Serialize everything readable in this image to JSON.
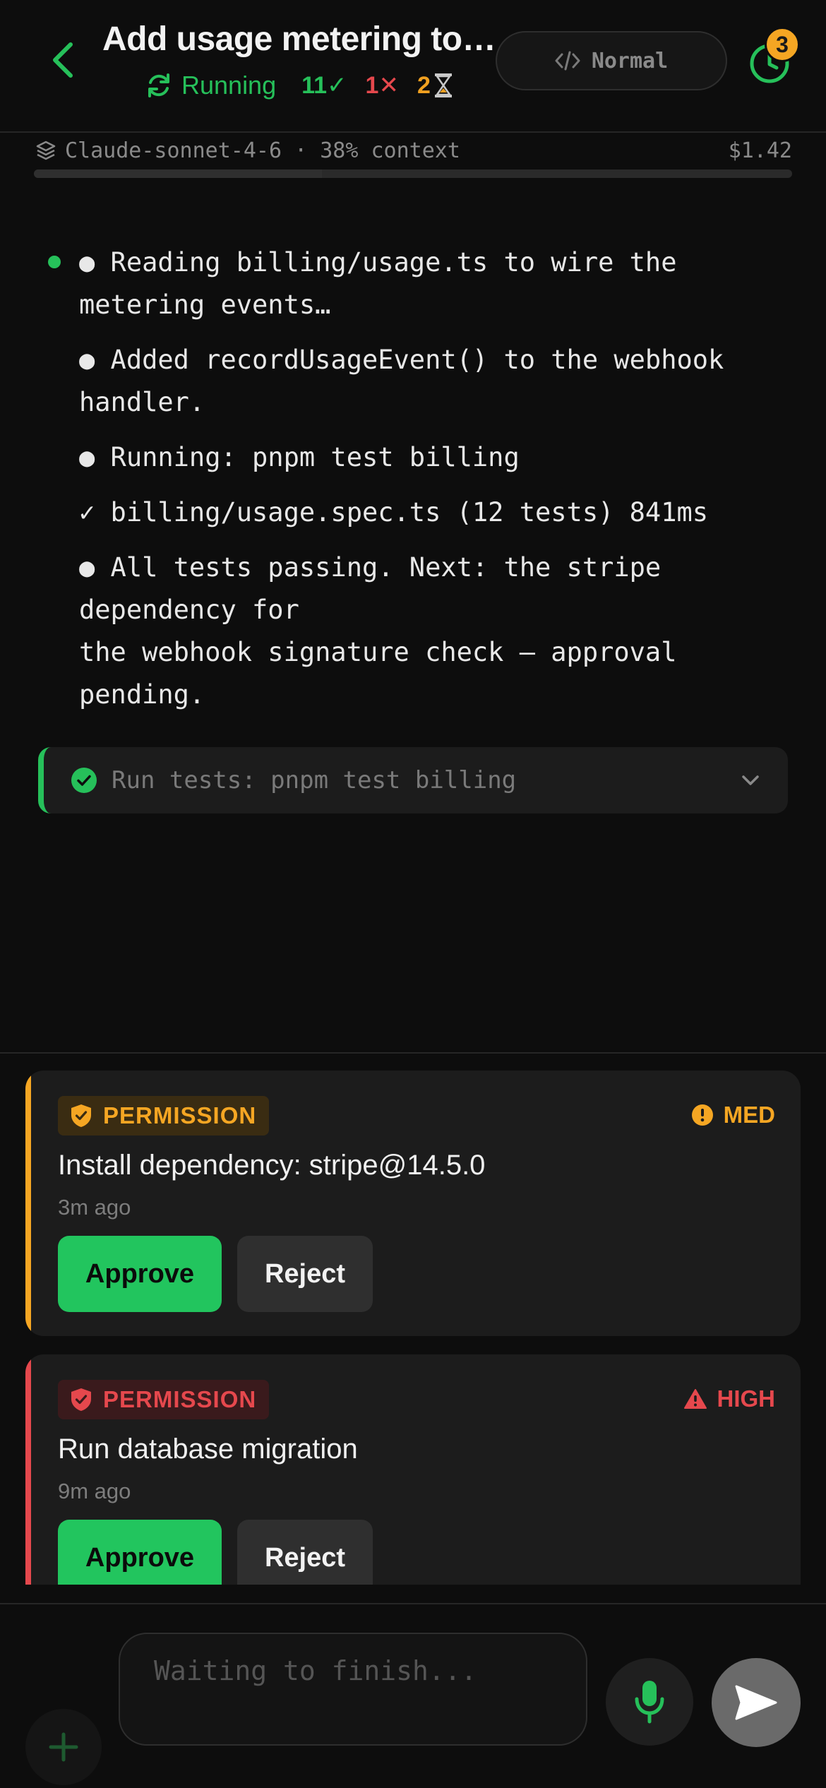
{
  "header": {
    "title": "Add usage metering to the billing webhook",
    "status": "Running",
    "passed_count": "11✓",
    "failed_count": "1✕",
    "pending_count": "2",
    "mode_label": "Normal",
    "history_badge": "3"
  },
  "model_bar": {
    "model_info": "Claude-sonnet-4-6 · 38% context",
    "cost": "$1.42",
    "context_percent": 38
  },
  "log": [
    "● Reading billing/usage.ts to wire the",
    "metering events…",
    "● Added recordUsageEvent() to the webhook",
    "handler.",
    "● Running: pnpm test billing",
    "✓ billing/usage.spec.ts (12 tests) 841ms",
    "● All tests passing. Next: the stripe",
    "dependency for",
    "the webhook signature check — approval",
    "pending."
  ],
  "tool_call": {
    "label": "Run tests: pnpm test billing"
  },
  "permissions": [
    {
      "tag": "PERMISSION",
      "risk": "MED",
      "title": "Install dependency: stripe@14.5.0",
      "time": "3m ago",
      "approve_label": "Approve",
      "reject_label": "Reject"
    },
    {
      "tag": "PERMISSION",
      "risk": "HIGH",
      "title": "Run database migration",
      "time": "9m ago",
      "approve_label": "Approve",
      "reject_label": "Reject"
    }
  ],
  "composer": {
    "placeholder": "Waiting to finish..."
  },
  "colors": {
    "accent_green": "#26c05a",
    "med_orange": "#f5a623",
    "high_red": "#e5484d"
  }
}
